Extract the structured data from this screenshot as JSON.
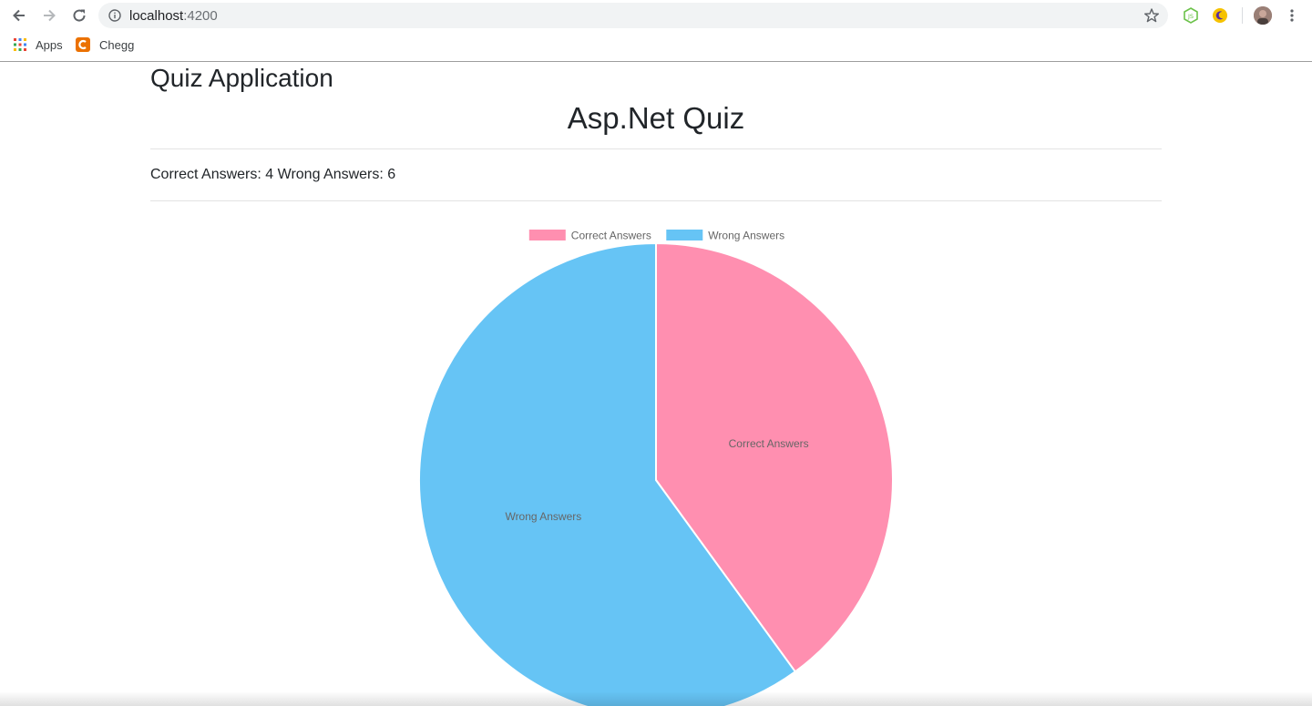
{
  "browser": {
    "url_host": "localhost",
    "url_port": ":4200",
    "bookmarks": [
      {
        "label": "Apps",
        "icon": "apps-grid-icon"
      },
      {
        "label": "Chegg",
        "icon": "chegg-icon"
      }
    ]
  },
  "page": {
    "app_title": "Quiz Application",
    "quiz_title": "Asp.Net Quiz",
    "correct_label": "Correct Answers:",
    "correct_count": "4",
    "wrong_label": "Wrong Answers:",
    "wrong_count": "6"
  },
  "chart_data": {
    "type": "pie",
    "categories": [
      "Correct Answers",
      "Wrong Answers"
    ],
    "values": [
      4,
      6
    ],
    "colors": [
      "#ff8fb0",
      "#66c4f5"
    ],
    "legend": "top",
    "slice_labels": true
  }
}
